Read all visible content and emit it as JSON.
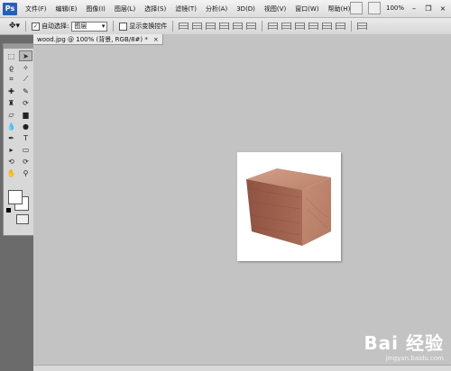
{
  "menubar": {
    "logo": "Ps",
    "items": [
      "文件(F)",
      "编辑(E)",
      "图像(I)",
      "图层(L)",
      "选择(S)",
      "滤镜(T)",
      "分析(A)",
      "3D(D)",
      "视图(V)",
      "窗口(W)",
      "帮助(H)"
    ],
    "zoom": "100%"
  },
  "options": {
    "auto_select_label": "自动选择:",
    "auto_select_value": "图层",
    "show_transform_label": "显示变换控件"
  },
  "document": {
    "tab_title": "wood.jpg @ 100% (背景, RGB/8#) *",
    "close": "×"
  },
  "watermark": {
    "main": "Bai  经验",
    "sub": "jingyan.baidu.com"
  },
  "colors": {
    "accent": "#2660b8",
    "canvas_bg": "#c3c3c3",
    "wood": "#b87a62"
  }
}
